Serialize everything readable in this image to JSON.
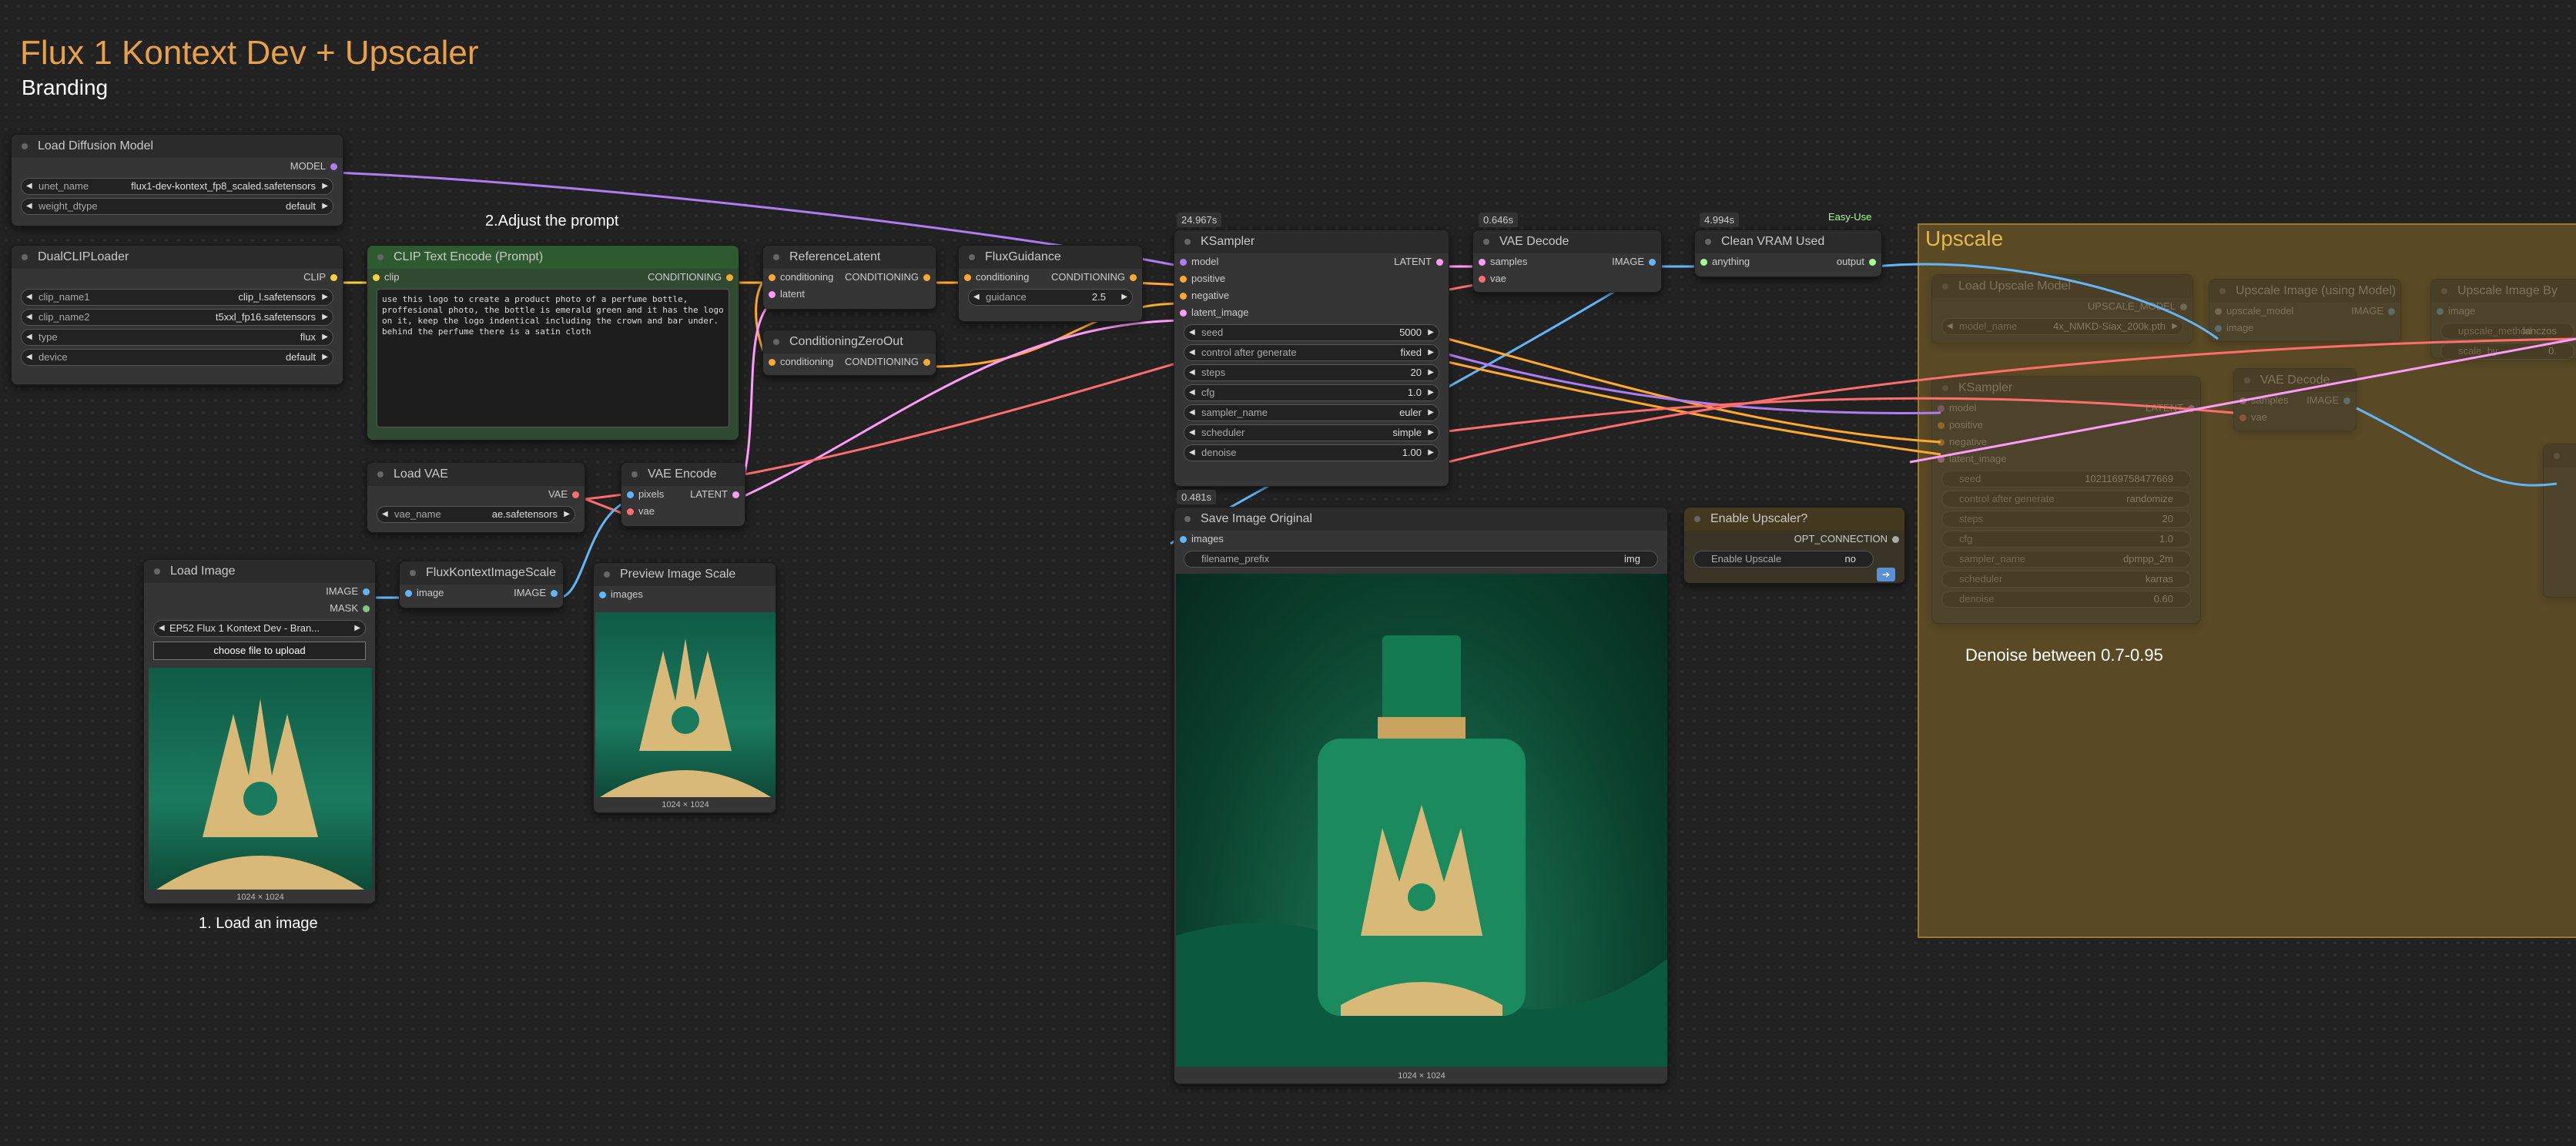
{
  "header": {
    "title": "Flux 1 Kontext Dev + Upscaler",
    "subtitle": "Branding"
  },
  "notes": {
    "adjust_prompt": "2.Adjust the prompt",
    "load_image": "1. Load an image",
    "denoise": "Denoise between 0.7-0.95"
  },
  "timings": {
    "ksampler": "24.967s",
    "vae_decode": "0.646s",
    "clean_vram": "4.994s",
    "save_image": "0.481s"
  },
  "easy_use_label": "Easy-Use",
  "colors": {
    "model": "#b07cf0",
    "clip": "#f7d13d",
    "conditioning": "#ffa931",
    "latent": "#ff9cf9",
    "vae": "#ff6e6e",
    "image": "#64b5f6",
    "opt": "#aaaaaa",
    "upscale_group": "#8a6a20",
    "title": "#e8a14a"
  },
  "nodes": {
    "load_diffusion": {
      "title": "Load Diffusion Model",
      "output": "MODEL",
      "unet_name_label": "unet_name",
      "unet_name": "flux1-dev-kontext_fp8_scaled.safetensors",
      "weight_dtype_label": "weight_dtype",
      "weight_dtype": "default"
    },
    "dual_clip": {
      "title": "DualCLIPLoader",
      "output": "CLIP",
      "clip_name1_label": "clip_name1",
      "clip_name1": "clip_l.safetensors",
      "clip_name2_label": "clip_name2",
      "clip_name2": "t5xxl_fp16.safetensors",
      "type_label": "type",
      "type": "flux",
      "device_label": "device",
      "device": "default"
    },
    "clip_text": {
      "title": "CLIP Text Encode (Prompt)",
      "input": "clip",
      "output": "CONDITIONING",
      "text": "use this logo to create a product photo of a perfume bottle, proffesional photo, the bottle is emerald green and it has the logo on it, keep the logo indentical including the crown and bar under. behind the perfume there is a satin cloth"
    },
    "reference_latent": {
      "title": "ReferenceLatent",
      "in1": "conditioning",
      "in2": "latent",
      "output": "CONDITIONING"
    },
    "cond_zero": {
      "title": "ConditioningZeroOut",
      "in1": "conditioning",
      "output": "CONDITIONING"
    },
    "flux_guidance": {
      "title": "FluxGuidance",
      "in1": "conditioning",
      "output": "CONDITIONING",
      "guidance_label": "guidance",
      "guidance": "2.5"
    },
    "ksampler": {
      "title": "KSampler",
      "in_model": "model",
      "in_positive": "positive",
      "in_negative": "negative",
      "in_latent": "latent_image",
      "output": "LATENT",
      "seed_label": "seed",
      "seed": "5000",
      "control_label": "control after generate",
      "control": "fixed",
      "steps_label": "steps",
      "steps": "20",
      "cfg_label": "cfg",
      "cfg": "1.0",
      "sampler_label": "sampler_name",
      "sampler": "euler",
      "scheduler_label": "scheduler",
      "scheduler": "simple",
      "denoise_label": "denoise",
      "denoise": "1.00"
    },
    "vae_decode": {
      "title": "VAE Decode",
      "in1": "samples",
      "in2": "vae",
      "output": "IMAGE"
    },
    "clean_vram": {
      "title": "Clean VRAM Used",
      "in1": "anything",
      "output": "output"
    },
    "load_vae": {
      "title": "Load VAE",
      "output": "VAE",
      "vae_name_label": "vae_name",
      "vae_name": "ae.safetensors"
    },
    "vae_encode": {
      "title": "VAE Encode",
      "in1": "pixels",
      "in2": "vae",
      "output": "LATENT"
    },
    "load_image": {
      "title": "Load Image",
      "out1": "IMAGE",
      "out2": "MASK",
      "image": "EP52 Flux 1 Kontext Dev - Bran...",
      "upload": "choose file to upload",
      "size": "1024 × 1024"
    },
    "flux_scale": {
      "title": "FluxKontextImageScale",
      "in1": "image",
      "output": "IMAGE"
    },
    "preview_scale": {
      "title": "Preview Image Scale",
      "in1": "images",
      "size": "1024 × 1024"
    },
    "save_image": {
      "title": "Save Image Original",
      "in1": "images",
      "prefix_label": "filename_prefix",
      "prefix": "img",
      "size": "1024 × 1024"
    },
    "enable_upscaler": {
      "title": "Enable Upscaler?",
      "output": "OPT_CONNECTION",
      "toggle_label": "Enable Upscale",
      "toggle_value": "no"
    }
  },
  "upscale_group": {
    "title": "Upscale",
    "load_upscale": {
      "title": "Load Upscale Model",
      "output": "UPSCALE_MODEL",
      "model_name_label": "model_name",
      "model_name": "4x_NMKD-Siax_200k.pth"
    },
    "upscale_image_model": {
      "title": "Upscale Image (using Model)",
      "in1": "upscale_model",
      "in2": "image",
      "output": "IMAGE"
    },
    "upscale_image_by": {
      "title": "Upscale Image By",
      "in1": "image",
      "w1": "upscale_method",
      "w1v": "lanczos",
      "w2": "scale_by",
      "w2v": "0."
    },
    "ksampler2": {
      "title": "KSampler",
      "in_model": "model",
      "in_positive": "positive",
      "in_negative": "negative",
      "in_latent": "latent_image",
      "output": "LATENT",
      "seed_label": "seed",
      "seed": "1021169758477669",
      "control_label": "control after generate",
      "control": "randomize",
      "steps_label": "steps",
      "steps": "20",
      "cfg_label": "cfg",
      "cfg": "1.0",
      "sampler_label": "sampler_name",
      "sampler": "dpmpp_2m",
      "scheduler_label": "scheduler",
      "scheduler": "karras",
      "denoise_label": "denoise",
      "denoise": "0.60"
    },
    "vae_decode2": {
      "title": "VAE Decode",
      "in1": "samples",
      "in2": "vae",
      "output": "IMAGE"
    }
  }
}
